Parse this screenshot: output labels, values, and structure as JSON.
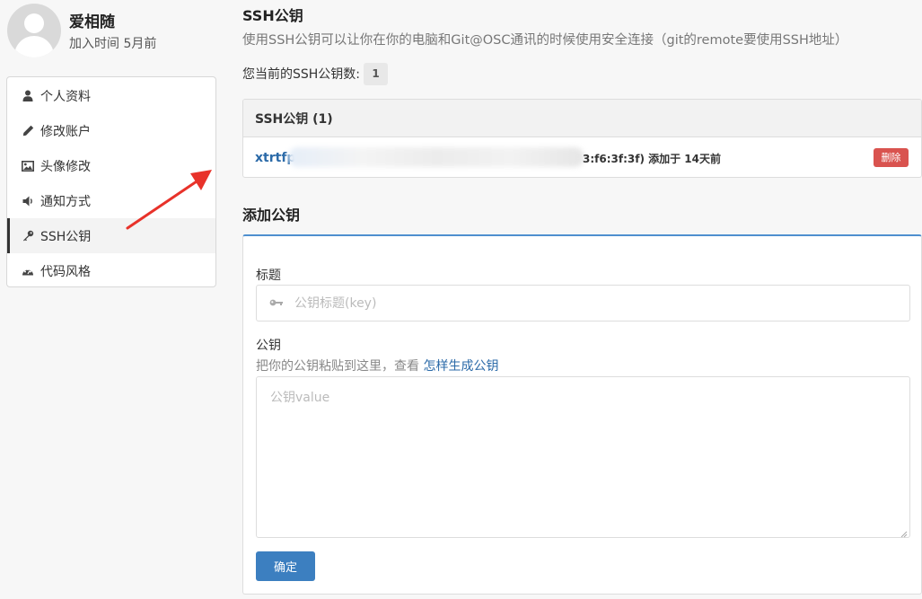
{
  "profile": {
    "name": "爱相随",
    "joined": "加入时间 5月前"
  },
  "sidebar": {
    "items": [
      {
        "label": "个人资料",
        "icon": "user-icon"
      },
      {
        "label": "修改账户",
        "icon": "pencil-icon"
      },
      {
        "label": "头像修改",
        "icon": "image-icon"
      },
      {
        "label": "通知方式",
        "icon": "volume-icon"
      },
      {
        "label": "SSH公钥",
        "icon": "key-icon",
        "active": true
      },
      {
        "label": "代码风格",
        "icon": "dashboard-icon"
      }
    ]
  },
  "ssh": {
    "title": "SSH公钥",
    "description": "使用SSH公钥可以让你在你的电脑和Git@OSC通讯的时候使用安全连接（git的remote要使用SSH地址）",
    "count_label": "您当前的SSH公钥数:",
    "count": "1",
    "panel_title": "SSH公钥 (1)",
    "key": {
      "name": "xtrtfp",
      "fingerprint_suffix": "3:f6:3f:3f) 添加于 14天前",
      "delete_label": "删除"
    }
  },
  "add": {
    "title": "添加公钥",
    "title_label": "标题",
    "title_placeholder": "公钥标题(key)",
    "key_label": "公钥",
    "hint_text": "把你的公钥粘贴到这里，查看",
    "hint_link": "怎样生成公钥",
    "key_placeholder": "公钥value",
    "submit_label": "确定"
  },
  "colors": {
    "link": "#2b6aa8",
    "danger": "#d9534f",
    "primary": "#3c7fc0",
    "arrow": "#e8322a"
  }
}
